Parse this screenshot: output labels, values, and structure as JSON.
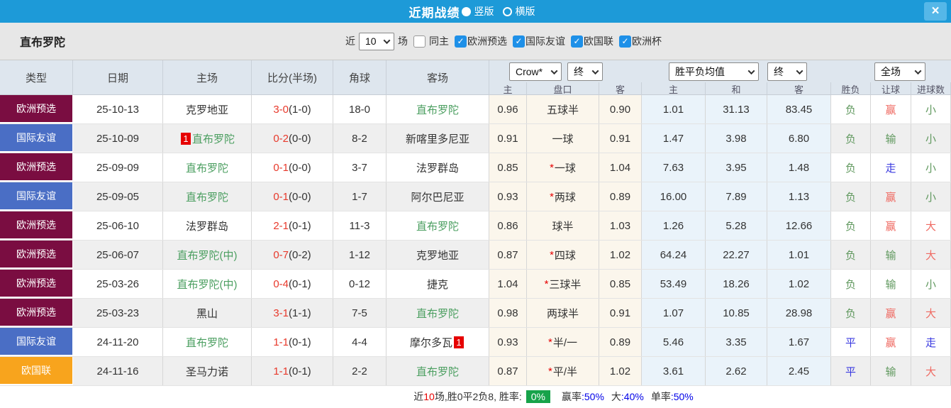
{
  "titlebar": {
    "title": "近期战绩",
    "layout_options": [
      {
        "label": "竖版",
        "selected": true
      },
      {
        "label": "横版",
        "selected": false
      }
    ],
    "close_glyph": "×"
  },
  "filters": {
    "team": "直布罗陀",
    "near_label": "近",
    "match_count": "10",
    "games_label": "场",
    "same_home": {
      "label": "同主",
      "checked": false
    },
    "competitions": [
      {
        "label": "欧洲预选",
        "checked": true
      },
      {
        "label": "国际友谊",
        "checked": true
      },
      {
        "label": "欧国联",
        "checked": true
      },
      {
        "label": "欧洲杯",
        "checked": true
      }
    ]
  },
  "table": {
    "main_headers": [
      "类型",
      "日期",
      "主场",
      "比分(半场)",
      "角球",
      "客场"
    ],
    "dropdowns": {
      "bookmaker": "Crow*",
      "bookmaker_time": "终",
      "avg": "胜平负均值",
      "avg_time": "终",
      "scope": "全场"
    },
    "sub_headers": [
      "主",
      "盘口",
      "客",
      "主",
      "和",
      "客",
      "胜负",
      "让球",
      "进球数"
    ],
    "type_colors": {
      "欧洲预选": "#7a0d41",
      "国际友谊": "#4a6ec5",
      "欧国联": "#f8a41d"
    },
    "rows": [
      {
        "type": "欧洲预选",
        "date": "25-10-13",
        "home": "克罗地亚",
        "home_green": false,
        "home_badge": "",
        "score": "3-0",
        "half": "(1-0)",
        "corners": "18-0",
        "away": "直布罗陀",
        "away_green": true,
        "away_badge": "",
        "odds_home": "0.96",
        "handicap": "五球半",
        "handicap_star": false,
        "odds_away": "0.90",
        "avg_home": "1.01",
        "avg_draw": "31.13",
        "avg_away": "83.45",
        "result": "负",
        "result_c": "green",
        "let_res": "赢",
        "let_c": "red",
        "goal": "小",
        "goal_c": "green"
      },
      {
        "type": "国际友谊",
        "date": "25-10-09",
        "home": "直布罗陀",
        "home_green": true,
        "home_badge": "1",
        "score": "0-2",
        "half": "(0-0)",
        "corners": "8-2",
        "away": "新喀里多尼亚",
        "away_green": false,
        "away_badge": "",
        "odds_home": "0.91",
        "handicap": "一球",
        "handicap_star": false,
        "odds_away": "0.91",
        "avg_home": "1.47",
        "avg_draw": "3.98",
        "avg_away": "6.80",
        "result": "负",
        "result_c": "green",
        "let_res": "输",
        "let_c": "green",
        "goal": "小",
        "goal_c": "green"
      },
      {
        "type": "欧洲预选",
        "date": "25-09-09",
        "home": "直布罗陀",
        "home_green": true,
        "home_badge": "",
        "score": "0-1",
        "half": "(0-0)",
        "corners": "3-7",
        "away": "法罗群岛",
        "away_green": false,
        "away_badge": "",
        "odds_home": "0.85",
        "handicap": "一球",
        "handicap_star": true,
        "odds_away": "1.04",
        "avg_home": "7.63",
        "avg_draw": "3.95",
        "avg_away": "1.48",
        "result": "负",
        "result_c": "green",
        "let_res": "走",
        "let_c": "blue",
        "goal": "小",
        "goal_c": "green"
      },
      {
        "type": "国际友谊",
        "date": "25-09-05",
        "home": "直布罗陀",
        "home_green": true,
        "home_badge": "",
        "score": "0-1",
        "half": "(0-0)",
        "corners": "1-7",
        "away": "阿尔巴尼亚",
        "away_green": false,
        "away_badge": "",
        "odds_home": "0.93",
        "handicap": "两球",
        "handicap_star": true,
        "odds_away": "0.89",
        "avg_home": "16.00",
        "avg_draw": "7.89",
        "avg_away": "1.13",
        "result": "负",
        "result_c": "green",
        "let_res": "赢",
        "let_c": "red",
        "goal": "小",
        "goal_c": "green"
      },
      {
        "type": "欧洲预选",
        "date": "25-06-10",
        "home": "法罗群岛",
        "home_green": false,
        "home_badge": "",
        "score": "2-1",
        "half": "(0-1)",
        "corners": "11-3",
        "away": "直布罗陀",
        "away_green": true,
        "away_badge": "",
        "odds_home": "0.86",
        "handicap": "球半",
        "handicap_star": false,
        "odds_away": "1.03",
        "avg_home": "1.26",
        "avg_draw": "5.28",
        "avg_away": "12.66",
        "result": "负",
        "result_c": "green",
        "let_res": "赢",
        "let_c": "red",
        "goal": "大",
        "goal_c": "red"
      },
      {
        "type": "欧洲预选",
        "date": "25-06-07",
        "home": "直布罗陀(中)",
        "home_green": true,
        "home_badge": "",
        "score": "0-7",
        "half": "(0-2)",
        "corners": "1-12",
        "away": "克罗地亚",
        "away_green": false,
        "away_badge": "",
        "odds_home": "0.87",
        "handicap": "四球",
        "handicap_star": true,
        "odds_away": "1.02",
        "avg_home": "64.24",
        "avg_draw": "22.27",
        "avg_away": "1.01",
        "result": "负",
        "result_c": "green",
        "let_res": "输",
        "let_c": "green",
        "goal": "大",
        "goal_c": "red"
      },
      {
        "type": "欧洲预选",
        "date": "25-03-26",
        "home": "直布罗陀(中)",
        "home_green": true,
        "home_badge": "",
        "score": "0-4",
        "half": "(0-1)",
        "corners": "0-12",
        "away": "捷克",
        "away_green": false,
        "away_badge": "",
        "odds_home": "1.04",
        "handicap": "三球半",
        "handicap_star": true,
        "odds_away": "0.85",
        "avg_home": "53.49",
        "avg_draw": "18.26",
        "avg_away": "1.02",
        "result": "负",
        "result_c": "green",
        "let_res": "输",
        "let_c": "green",
        "goal": "小",
        "goal_c": "green"
      },
      {
        "type": "欧洲预选",
        "date": "25-03-23",
        "home": "黑山",
        "home_green": false,
        "home_badge": "",
        "score": "3-1",
        "half": "(1-1)",
        "corners": "7-5",
        "away": "直布罗陀",
        "away_green": true,
        "away_badge": "",
        "odds_home": "0.98",
        "handicap": "两球半",
        "handicap_star": false,
        "odds_away": "0.91",
        "avg_home": "1.07",
        "avg_draw": "10.85",
        "avg_away": "28.98",
        "result": "负",
        "result_c": "green",
        "let_res": "赢",
        "let_c": "red",
        "goal": "大",
        "goal_c": "red"
      },
      {
        "type": "国际友谊",
        "date": "24-11-20",
        "home": "直布罗陀",
        "home_green": true,
        "home_badge": "",
        "score": "1-1",
        "half": "(0-1)",
        "corners": "4-4",
        "away": "摩尔多瓦",
        "away_green": false,
        "away_badge": "1",
        "odds_home": "0.93",
        "handicap": "半/一",
        "handicap_star": true,
        "odds_away": "0.89",
        "avg_home": "5.46",
        "avg_draw": "3.35",
        "avg_away": "1.67",
        "result": "平",
        "result_c": "blue",
        "let_res": "赢",
        "let_c": "red",
        "goal": "走",
        "goal_c": "blue"
      },
      {
        "type": "欧国联",
        "date": "24-11-16",
        "home": "圣马力诺",
        "home_green": false,
        "home_badge": "",
        "score": "1-1",
        "half": "(0-1)",
        "corners": "2-2",
        "away": "直布罗陀",
        "away_green": true,
        "away_badge": "",
        "odds_home": "0.87",
        "handicap": "平/半",
        "handicap_star": true,
        "odds_away": "1.02",
        "avg_home": "3.61",
        "avg_draw": "2.62",
        "avg_away": "2.45",
        "result": "平",
        "result_c": "blue",
        "let_res": "输",
        "let_c": "green",
        "goal": "大",
        "goal_c": "red"
      }
    ]
  },
  "footer": {
    "near_label": "近",
    "count": "10",
    "summary": "场,胜0平2负8, 胜率:",
    "win_rate": "0%",
    "stats": [
      {
        "label": "赢率",
        "value": ":50%"
      },
      {
        "label": "大",
        "value": ":40%"
      },
      {
        "label": "单率",
        "value": ":50%"
      }
    ]
  },
  "colors": {
    "accent_blue": "#1d9ad8",
    "type_maroon": "#7a0d41",
    "type_blue": "#4a6ec5",
    "type_orange": "#f8a41d",
    "team_green": "#4a9e5f",
    "score_red": "#e8392b",
    "result_green": "#61995f",
    "result_red": "#ef6a62",
    "result_blue": "#3a3ae0",
    "win_rate_bg": "#17a34a",
    "stat_value_blue": "#0000e8",
    "crow_col_bg": "#fbf6ec",
    "avg_col_bg": "#eaf3fa"
  }
}
